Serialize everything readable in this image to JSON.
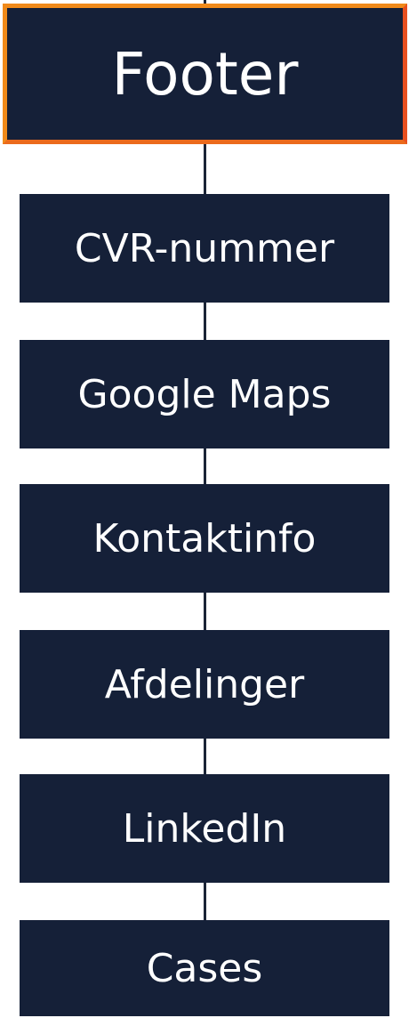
{
  "diagram": {
    "root": {
      "label": "Footer"
    },
    "children": [
      {
        "label": "CVR-nummer"
      },
      {
        "label": "Google Maps"
      },
      {
        "label": "Kontaktinfo"
      },
      {
        "label": "Afdelinger"
      },
      {
        "label": "LinkedIn"
      },
      {
        "label": "Cases"
      }
    ],
    "colors": {
      "node_fill": "#152038",
      "node_text": "#ffffff",
      "root_border": "#f08a1a",
      "connector": "#1b2436"
    }
  }
}
